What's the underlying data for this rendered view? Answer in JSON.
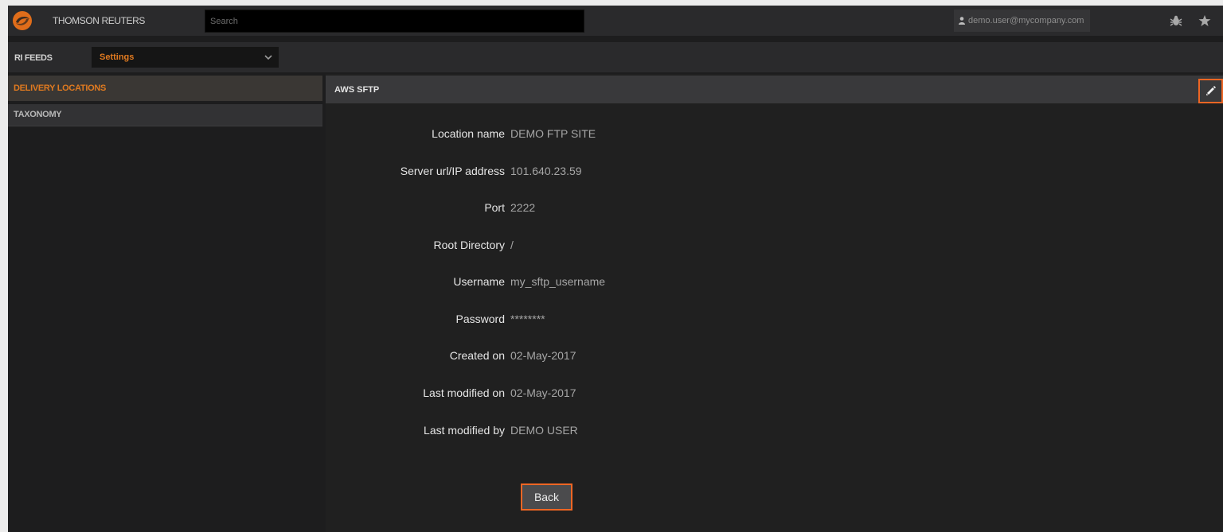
{
  "header": {
    "brand": "THOMSON REUTERS",
    "search": {
      "placeholder": "Search",
      "value": ""
    },
    "user": {
      "email": "demo.user@mycompany.com"
    },
    "icons": [
      "logo-icon",
      "user-icon",
      "bug-icon",
      "star-icon"
    ]
  },
  "subnav": {
    "label": "RI FEEDS",
    "selected": "Settings"
  },
  "sidebar": {
    "items": [
      {
        "label": "DELIVERY LOCATIONS",
        "active": true
      },
      {
        "label": "TAXONOMY",
        "active": false
      }
    ]
  },
  "panel": {
    "title": "AWS SFTP",
    "fields": [
      {
        "label": "Location name",
        "value": "DEMO FTP SITE"
      },
      {
        "label": "Server url/IP address",
        "value": "101.640.23.59"
      },
      {
        "label": "Port",
        "value": "2222"
      },
      {
        "label": "Root Directory",
        "value": "/"
      },
      {
        "label": "Username",
        "value": "my_sftp_username"
      },
      {
        "label": "Password",
        "value": "********"
      },
      {
        "label": "Created on",
        "value": "02-May-2017"
      },
      {
        "label": "Last modified on",
        "value": "02-May-2017"
      },
      {
        "label": "Last modified by",
        "value": "DEMO USER"
      }
    ],
    "back_label": "Back"
  },
  "colors": {
    "accent": "#e07a20",
    "highlight_border": "#ee6624",
    "background": "#1d1d1e",
    "bar": "#2a2a2c",
    "panel_header": "#39393b"
  }
}
